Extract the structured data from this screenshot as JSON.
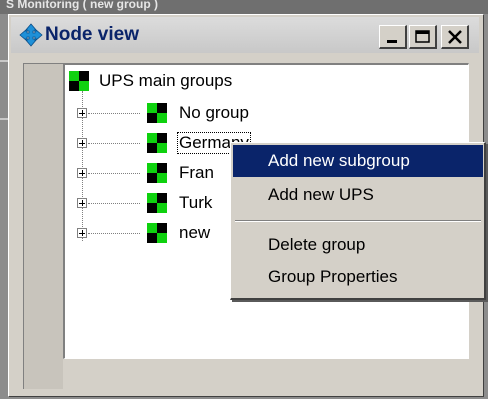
{
  "background_window": {
    "title_fragment": "S Monitoring ( new group )"
  },
  "window": {
    "title": "Node view",
    "controls": {
      "minimize": "minimize-icon",
      "maximize": "maximize-icon",
      "close": "close-icon"
    }
  },
  "tree": {
    "root": {
      "label": "UPS main groups",
      "icon": "group-node-icon"
    },
    "children": [
      {
        "label": "No group",
        "icon": "group-node-icon",
        "expander": "plus"
      },
      {
        "label": "Germany",
        "icon": "group-node-icon",
        "expander": "plus",
        "selected": true
      },
      {
        "label": "Fran",
        "icon": "group-node-icon",
        "expander": "plus"
      },
      {
        "label": "Turk",
        "icon": "group-node-icon",
        "expander": "plus"
      },
      {
        "label": "new",
        "icon": "group-node-icon",
        "expander": "plus"
      }
    ]
  },
  "context_menu": {
    "items": [
      {
        "label": "Add new subgroup",
        "highlighted": true
      },
      {
        "label": "Add new UPS",
        "highlighted": false
      },
      {
        "label": "Delete group",
        "highlighted": false
      },
      {
        "label": "Group Properties",
        "highlighted": false
      }
    ]
  },
  "colors": {
    "highlight": "#0a246a",
    "title_text": "#0a246a",
    "window_face": "#d4d0c8"
  }
}
